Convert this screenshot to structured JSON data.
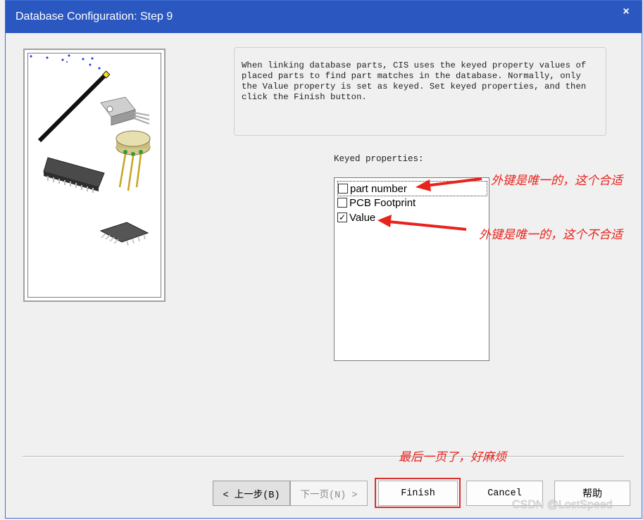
{
  "window": {
    "title": "Database Configuration: Step 9",
    "close_glyph": "×"
  },
  "info": {
    "lines": [
      "When linking database parts, CIS uses the keyed property values of",
      "placed parts to find part matches in the database. Normally, only",
      "the Value property is set as keyed. Set keyed properties, and then",
      "click the Finish button."
    ]
  },
  "keyed": {
    "label": "Keyed properties:",
    "items": [
      {
        "label": "part number",
        "checked": false
      },
      {
        "label": "PCB Footprint",
        "checked": false
      },
      {
        "label": "Value",
        "checked": true
      }
    ]
  },
  "buttons": {
    "back": "< 上一步(B)",
    "next": "下一页(N) >",
    "finish": "Finish",
    "cancel": "Cancel",
    "help": "帮助"
  },
  "annotations": {
    "part_number_note": "外键是唯一的，这个合适",
    "value_note": "外键是唯一的，这个不合适",
    "finish_note": "最后一页了，好麻烦"
  },
  "watermark": "CSDN @LostSpeed",
  "colors": {
    "titlebar": "#2b58c0",
    "annotation_red": "#e8231c"
  }
}
